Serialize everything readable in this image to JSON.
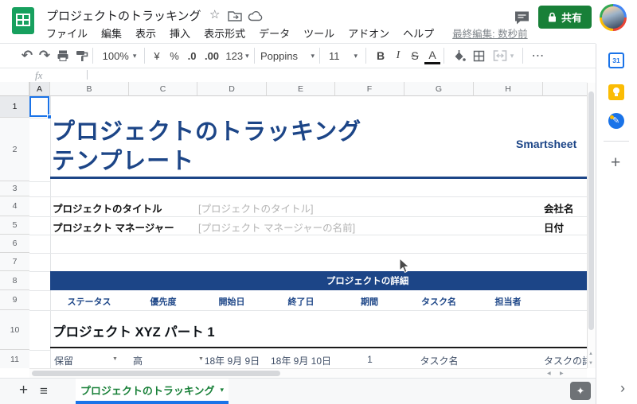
{
  "header": {
    "doc_title": "プロジェクトのトラッキング",
    "menus": [
      "ファイル",
      "編集",
      "表示",
      "挿入",
      "表示形式",
      "データ",
      "ツール",
      "アドオン",
      "ヘルプ"
    ],
    "last_edited": "最終編集: 数秒前",
    "share_label": "共有"
  },
  "toolbar": {
    "zoom": "100%",
    "currency": "¥",
    "percent": "%",
    "decimal_decrease": ".0",
    "decimal_increase": ".00",
    "number_format": "123",
    "font_name": "Poppins",
    "font_size": "11",
    "bold": "B",
    "italic": "I",
    "strikethrough": "S",
    "text_color": "A",
    "more": "⋯"
  },
  "formula_bar": {
    "label": "fx"
  },
  "grid": {
    "column_headers": [
      "A",
      "B",
      "C",
      "D",
      "E",
      "F",
      "G",
      "H"
    ],
    "row_headers": [
      "1",
      "2",
      "3",
      "4",
      "5",
      "6",
      "7",
      "8",
      "9",
      "10",
      "11"
    ]
  },
  "sheet": {
    "title_line1": "プロジェクトのトラッキング",
    "title_line2": "テンプレート",
    "brand": "Smartsheet",
    "fields": [
      {
        "label": "プロジェクトのタイトル",
        "value": "[プロジェクトのタイトル]"
      },
      {
        "label": "プロジェクト マネージャー",
        "value": "[プロジェクト マネージャーの名前]"
      }
    ],
    "side_labels": [
      {
        "label": "会社名"
      },
      {
        "label": "日付"
      }
    ],
    "details_banner": "プロジェクトの詳細",
    "table_headers": [
      "ステータス",
      "優先度",
      "開始日",
      "終了日",
      "期間",
      "タスク名",
      "担当者"
    ],
    "section_title": "プロジェクト XYZ パート 1",
    "data_row": {
      "status": "保留",
      "priority": "高",
      "start_date": "18年 9月 9日",
      "end_date": "18年 9月 10日",
      "duration": "1",
      "task_name": "タスク名",
      "task_details": "タスクの詳細"
    }
  },
  "tab_bar": {
    "active_tab": "プロジェクトのトラッキング"
  },
  "icons": {
    "caret_down": "▾",
    "star": "☆",
    "undo": "↶",
    "redo": "↷",
    "plus": "+",
    "sheet_list": "≡",
    "chevron_right": "›",
    "scroll_up": "▲",
    "scroll_down": "▼",
    "scroll_left": "◀",
    "scroll_right": "▶",
    "cell_dropdown": "▼",
    "explore": "✦",
    "calendar_day": "31",
    "pencil": "✎"
  },
  "colors": {
    "accent_blue": "#1c4587",
    "selection_blue": "#1a73e8",
    "share_green": "#188038",
    "logo_green": "#0f9d58",
    "keep_yellow": "#fbbc04"
  }
}
